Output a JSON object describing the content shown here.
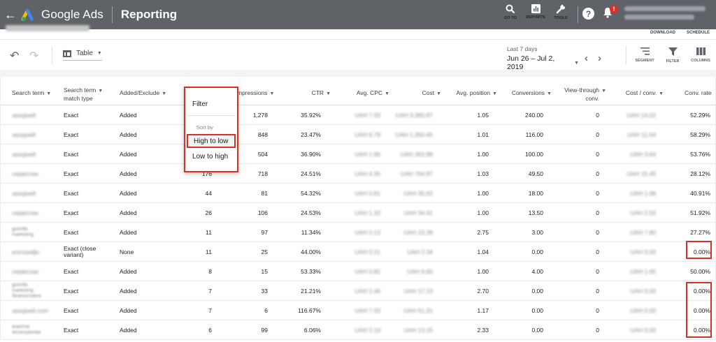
{
  "topbar": {
    "back_icon": "arrow-back-icon",
    "app_name": "Google Ads",
    "page_title": "Reporting",
    "actions": [
      {
        "label": "GO TO",
        "icon": "search-icon"
      },
      {
        "label": "REPORTS",
        "icon": "bar-chart-icon"
      },
      {
        "label": "TOOLS",
        "icon": "wrench-icon"
      }
    ],
    "help_icon": "?",
    "notification_badge": "!"
  },
  "subheader": {
    "download_label": "DOWNLOAD",
    "schedule_label": "SCHEDULE"
  },
  "toolbar": {
    "view_label": "Table",
    "date_label": "Last 7 days",
    "date_value": "Jun 26 – Jul 2, 2019",
    "segment_label": "SEGMENT",
    "filter_label": "FILTER",
    "columns_label": "COLUMNS"
  },
  "table": {
    "headers": {
      "search_term": "Search term",
      "match_type_1": "Search term",
      "match_type_2": "match type",
      "added_excluded": "Added/Exclude",
      "clicks": "",
      "impressions": "mpressions",
      "ctr": "CTR",
      "avg_cpc": "Avg. CPC",
      "cost": "Cost",
      "avg_position": "Avg. position",
      "conversions": "Conversions",
      "view_through_1": "View-through",
      "view_through_2": "conv.",
      "cost_conv": "Cost / conv.",
      "conv_rate": "Conv. rate"
    },
    "rows": [
      {
        "term": "західний",
        "term2": "",
        "term3": "",
        "match": "Exact",
        "match2": "",
        "added": "Added",
        "clicks": "",
        "impr": "1,278",
        "ctr": "35.92%",
        "cpc": "UAH 7.33",
        "cost": "UAH 3,365.67",
        "pos": "1.05",
        "conv": "240.00",
        "vtc": "0",
        "cpconv": "UAH 14.02",
        "rate": "52.29%"
      },
      {
        "term": "західний",
        "term2": "",
        "term3": "",
        "match": "Exact",
        "match2": "",
        "added": "Added",
        "clicks": "",
        "impr": "848",
        "ctr": "23.47%",
        "cpc": "UAH 6.79",
        "cost": "UAH 1,350.45",
        "pos": "1.01",
        "conv": "116.00",
        "vtc": "0",
        "cpconv": "UAH 11.64",
        "rate": "58.29%"
      },
      {
        "term": "західний",
        "term2": "",
        "term3": "",
        "match": "Exact",
        "match2": "",
        "added": "Added",
        "clicks": "",
        "impr": "504",
        "ctr": "36.90%",
        "cpc": "UAH 1.96",
        "cost": "UAH 363.98",
        "pos": "1.00",
        "conv": "100.00",
        "vtc": "0",
        "cpconv": "UAH 3.64",
        "rate": "53.76%"
      },
      {
        "term": "сервіслає",
        "term2": "",
        "term3": "",
        "match": "Exact",
        "match2": "",
        "added": "Added",
        "clicks": "176",
        "impr": "718",
        "ctr": "24.51%",
        "cpc": "UAH 4.35",
        "cost": "UAH 764.97",
        "pos": "1.03",
        "conv": "49.50",
        "vtc": "0",
        "cpconv": "UAH 15.45",
        "rate": "28.12%"
      },
      {
        "term": "західний",
        "term2": "",
        "term3": "",
        "match": "Exact",
        "match2": "",
        "added": "Added",
        "clicks": "44",
        "impr": "81",
        "ctr": "54.32%",
        "cpc": "UAH 0.81",
        "cost": "UAH 35.62",
        "pos": "1.00",
        "conv": "18.00",
        "vtc": "0",
        "cpconv": "UAH 1.98",
        "rate": "40.91%"
      },
      {
        "term": "сервіслає",
        "term2": "",
        "term3": "",
        "match": "Exact",
        "match2": "",
        "added": "Added",
        "clicks": "26",
        "impr": "106",
        "ctr": "24.53%",
        "cpc": "UAH 1.32",
        "cost": "UAH 34.41",
        "pos": "1.00",
        "conv": "13.50",
        "vtc": "0",
        "cpconv": "UAH 2.55",
        "rate": "51.92%"
      },
      {
        "term": "guerilla",
        "term2": "marketing",
        "term3": "",
        "match": "Exact",
        "match2": "",
        "added": "Added",
        "clicks": "11",
        "impr": "97",
        "ctr": "11.34%",
        "cpc": "UAH 2.13",
        "cost": "UAH 23.39",
        "pos": "2.75",
        "conv": "3.00",
        "vtc": "0",
        "cpconv": "UAH 7.80",
        "rate": "27.27%"
      },
      {
        "term": "ксклшифс",
        "term2": "",
        "term3": "",
        "match": "Exact (close",
        "match2": "variant)",
        "added": "None",
        "clicks": "11",
        "impr": "25",
        "ctr": "44.00%",
        "cpc": "UAH 0.21",
        "cost": "UAH 2.34",
        "pos": "1.04",
        "conv": "0.00",
        "vtc": "0",
        "cpconv": "UAH 0.00",
        "rate": "0.00%"
      },
      {
        "term": "сервіслає",
        "term2": "",
        "term3": "",
        "match": "Exact",
        "match2": "",
        "added": "Added",
        "clicks": "8",
        "impr": "15",
        "ctr": "53.33%",
        "cpc": "UAH 0.82",
        "cost": "UAH 6.60",
        "pos": "1.00",
        "conv": "4.00",
        "vtc": "0",
        "cpconv": "UAH 1.65",
        "rate": "50.00%"
      },
      {
        "term": "guerilla",
        "term2": "marketing",
        "term3": "безкоштовно",
        "match": "Exact",
        "match2": "",
        "added": "Added",
        "clicks": "7",
        "impr": "33",
        "ctr": "21.21%",
        "cpc": "UAH 2.46",
        "cost": "UAH 17.23",
        "pos": "2.70",
        "conv": "0.00",
        "vtc": "0",
        "cpconv": "UAH 0.00",
        "rate": "0.00%"
      },
      {
        "term": "західний.com",
        "term2": "",
        "term3": "",
        "match": "Exact",
        "match2": "",
        "added": "Added",
        "clicks": "7",
        "impr": "6",
        "ctr": "116.67%",
        "cpc": "UAH 7.33",
        "cost": "UAH 51.31",
        "pos": "1.17",
        "conv": "0.00",
        "vtc": "0",
        "cpconv": "UAH 0.00",
        "rate": "0.00%"
      },
      {
        "term": "анкетне",
        "term2": "оплачувалки",
        "term3": "",
        "match": "Exact",
        "match2": "",
        "added": "Added",
        "clicks": "6",
        "impr": "99",
        "ctr": "6.06%",
        "cpc": "UAH 2.19",
        "cost": "UAH 13.15",
        "pos": "2.33",
        "conv": "0.00",
        "vtc": "0",
        "cpconv": "UAH 0.00",
        "rate": "0.00%"
      }
    ]
  },
  "sort_menu": {
    "filter_label": "Filter",
    "sort_by_label": "Sort by",
    "high_to_low_label": "High to low",
    "low_to_high_label": "Low to high"
  },
  "colors": {
    "topbar": "#5f6368",
    "highlight": "#d93025"
  }
}
